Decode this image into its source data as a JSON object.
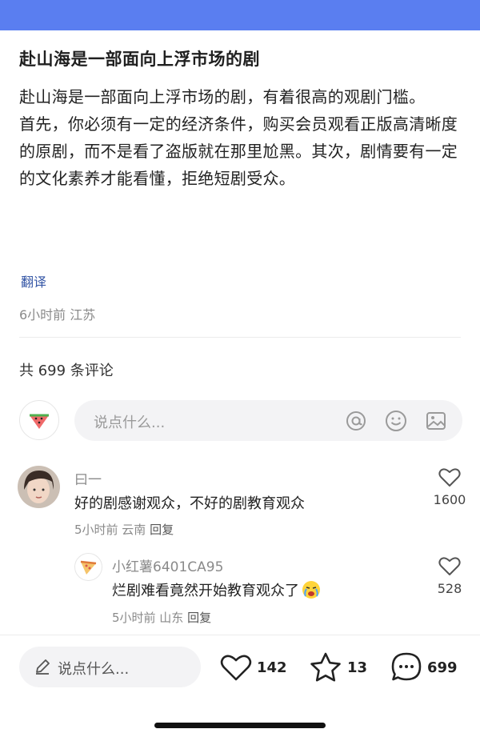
{
  "post": {
    "title": "赴山海是一部面向上浮市场的剧",
    "paragraph1": "赴山海是一部面向上浮市场的剧，有着很高的观剧门槛。",
    "paragraph2": "首先，你必须有一定的经济条件，购买会员观看正版高清晰度的原剧，而不是看了盗版就在那里尬黑。其次，剧情要有一定的文化素养才能看懂，拒绝短剧受众。",
    "translate_link": "翻译",
    "meta": "6小时前 江苏"
  },
  "comments_header": {
    "count_label": "共 699 条评论"
  },
  "comment_input": {
    "placeholder": "说点什么...",
    "icons": [
      "at-icon",
      "emoji-icon",
      "image-icon"
    ]
  },
  "comments": [
    {
      "name": "曰一",
      "text": "好的剧感谢观众，不好的剧教育观众",
      "time": "5小时前 云南",
      "reply_label": "回复",
      "likes": "1600"
    },
    {
      "name": "小红薯6401CA95",
      "text": "烂剧难看竟然开始教育观众了",
      "time": "5小时前 山东",
      "reply_label": "回复",
      "likes": "528"
    }
  ],
  "bottom_bar": {
    "placeholder": "说点什么...",
    "likes": "142",
    "favorites": "13",
    "comments": "699"
  },
  "colors": {
    "top_bar": "#5a7ef0",
    "link": "#3355a5",
    "muted": "#8a8a8a"
  }
}
